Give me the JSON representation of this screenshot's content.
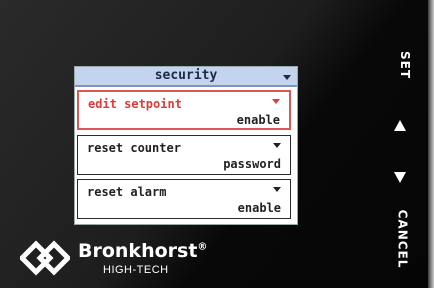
{
  "header": {
    "title": "security"
  },
  "menu": {
    "items": [
      {
        "label": "edit setpoint",
        "value": "enable",
        "selected": true
      },
      {
        "label": "reset counter",
        "value": "password",
        "selected": false
      },
      {
        "label": "reset alarm",
        "value": "enable",
        "selected": false
      }
    ]
  },
  "buttons": {
    "set": "SET",
    "cancel": "CANCEL"
  },
  "brand": {
    "name": "Bronkhorst",
    "mark": "®",
    "sub": "HIGH-TECH"
  },
  "colors": {
    "selected": "#e03a3a",
    "header_bg": "#c4d4ee"
  }
}
